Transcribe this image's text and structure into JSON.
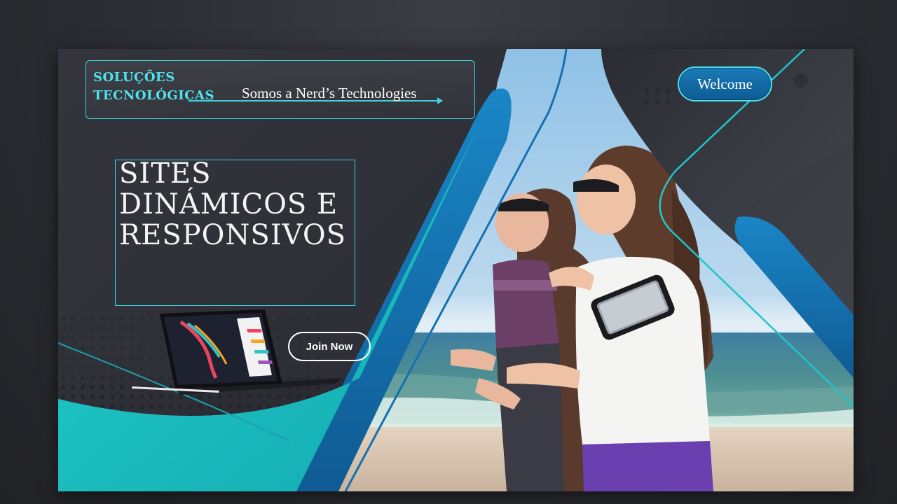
{
  "brand": {
    "title_line1": "SOLUÇÕES",
    "title_line2": "TECNOLÓGICAS",
    "tagline": "Somos a Nerd’s Technologies"
  },
  "header": {
    "welcome_label": "Welcome"
  },
  "hero": {
    "headline": "SITES DINÁMICOS E RESPONSIVOS",
    "join_label": "Join Now"
  },
  "colors": {
    "accent_cyan": "#3fd3e0",
    "teal": "#1fc2c2",
    "blue": "#1670b0",
    "dark_panel": "#2f3038"
  },
  "icons": {
    "photo": "two-women-running-on-beach-photo",
    "device": "tablet-with-keyboard-and-stylus-icon"
  }
}
